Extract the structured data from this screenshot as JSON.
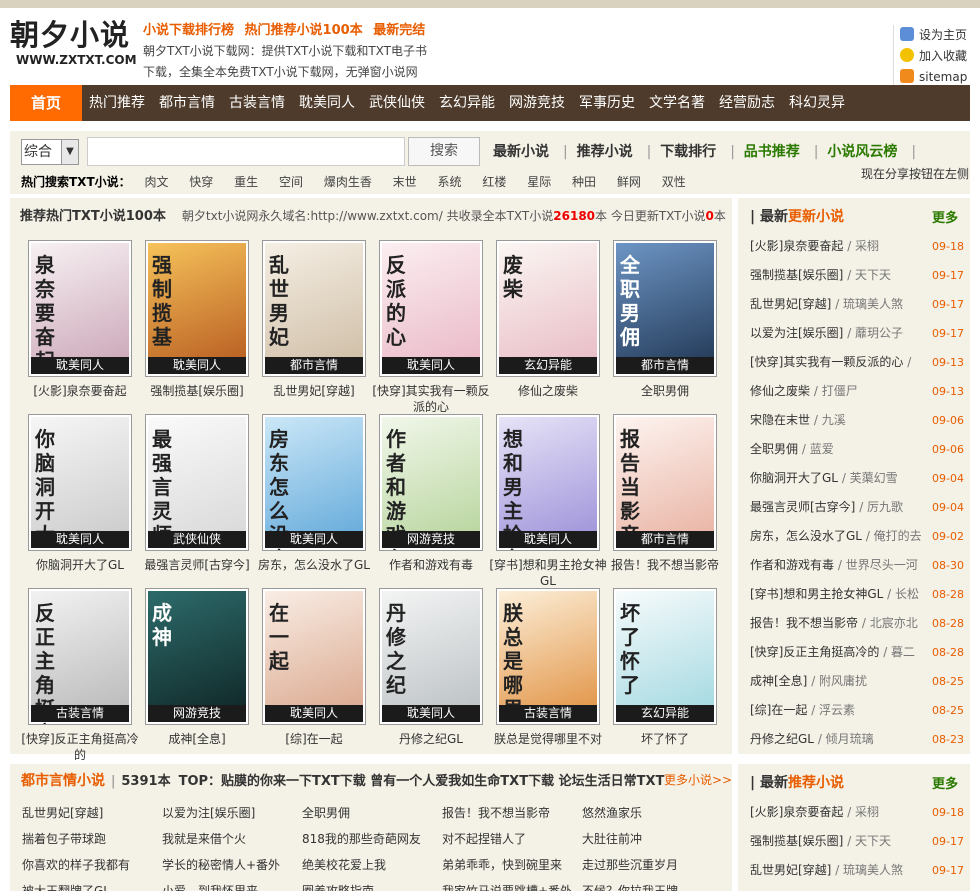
{
  "header": {
    "logo_text": "朝夕小说",
    "logo_url": "WWW.ZXTXT.COM",
    "links": [
      "小说下载排行榜",
      "热门推荐小说100本",
      "最新完结"
    ],
    "desc1": "朝夕TXT小说下载网：提供TXT小说下载和TXT电子书",
    "desc2": "下载，全集全本免费TXT小说下载网，无弹窗小说网",
    "side_links": [
      {
        "label": "设为主页",
        "icon": "home-icon",
        "color": "#5b8ed6"
      },
      {
        "label": "加入收藏",
        "icon": "star-icon",
        "color": "#f2c200"
      },
      {
        "label": "sitemap",
        "icon": "rss-icon",
        "color": "#f08a1c"
      }
    ]
  },
  "nav": [
    "首页",
    "热门推荐",
    "都市言情",
    "古装言情",
    "耽美同人",
    "武侠仙侠",
    "玄幻异能",
    "网游竞技",
    "军事历史",
    "文学名著",
    "经营励志",
    "科幻灵异"
  ],
  "search": {
    "select_value": "综合",
    "input_value": "",
    "button_label": "搜索",
    "quick_links": [
      "最新小说",
      "推荐小说",
      "下载排行",
      "品书推荐",
      "小说风云榜"
    ],
    "hot_label": "热门搜索TXT小说：",
    "hot_words": [
      "肉文",
      "快穿",
      "重生",
      "空间",
      "爆肉生香",
      "末世",
      "系统",
      "红楼",
      "星际",
      "种田",
      "鲜网",
      "双性"
    ],
    "share_tip": "现在分享按钮在左侧"
  },
  "main": {
    "title": "推荐热门TXT小说100本",
    "info_pre": "朝夕txt小说网永久域名:http://www.zxtxt.com/ 共收录全本TXT小说",
    "total": "26180",
    "info_mid": "本 今日更新TXT小说",
    "today": "0",
    "info_post": "本",
    "books": [
      {
        "name": "[火影]泉奈要奋起",
        "cat": "耽美同人",
        "cover": "泉奈要奋起",
        "c1": "#f7f1f3",
        "c2": "#c9a3b5"
      },
      {
        "name": "强制揽基[娱乐圈]",
        "cat": "耽美同人",
        "cover": "强制揽基",
        "c1": "#f6c25a",
        "c2": "#b5581f"
      },
      {
        "name": "乱世男妃[穿越]",
        "cat": "都市言情",
        "cover": "乱世男妃",
        "c1": "#f5efe4",
        "c2": "#cdbba3"
      },
      {
        "name": "[快穿]其实我有一颗反派的心",
        "cat": "耽美同人",
        "cover": "反派的心",
        "c1": "#fbeef1",
        "c2": "#e9b7c5"
      },
      {
        "name": "修仙之废柴",
        "cat": "玄幻异能",
        "cover": "废柴",
        "c1": "#fbf6f3",
        "c2": "#e7b9c3"
      },
      {
        "name": "全职男佣",
        "cat": "都市言情",
        "cover": "全职男佣",
        "c1": "#6d95c4",
        "c2": "#1f3552"
      },
      {
        "name": "你脑洞开大了GL",
        "cat": "耽美同人",
        "cover": "你脑洞开大了",
        "c1": "#f6f6f6",
        "c2": "#c9c9c9"
      },
      {
        "name": "最强言灵师[古穿今]",
        "cat": "武侠仙侠",
        "cover": "最强言灵师",
        "c1": "#fafafa",
        "c2": "#d7d7d7"
      },
      {
        "name": "房东，怎么没水了GL",
        "cat": "耽美同人",
        "cover": "房东怎么没水了",
        "c1": "#cbe7f7",
        "c2": "#5fa7d9"
      },
      {
        "name": "作者和游戏有毒",
        "cat": "网游竞技",
        "cover": "作者和游戏有毒",
        "c1": "#f1f7ea",
        "c2": "#b5d39a"
      },
      {
        "name": "[穿书]想和男主抢女神GL",
        "cat": "耽美同人",
        "cover": "想和男主抢女神",
        "c1": "#e7e3f7",
        "c2": "#9a8fd8"
      },
      {
        "name": "报告！我不想当影帝",
        "cat": "都市言情",
        "cover": "报告当影帝",
        "c1": "#fdf4f0",
        "c2": "#e8b0a0"
      },
      {
        "name": "[快穿]反正主角挺高冷的",
        "cat": "古装言情",
        "cover": "反正主角挺高冷",
        "c1": "#f2f2f2",
        "c2": "#b7b7b7"
      },
      {
        "name": "成神[全息]",
        "cat": "网游竞技",
        "cover": "成神",
        "c1": "#2d6b6b",
        "c2": "#0f2424"
      },
      {
        "name": "[综]在一起",
        "cat": "耽美同人",
        "cover": "在一起",
        "c1": "#f9ede5",
        "c2": "#d9a58a"
      },
      {
        "name": "丹修之纪GL",
        "cat": "耽美同人",
        "cover": "丹修之纪",
        "c1": "#f3f4f4",
        "c2": "#b9bfc2"
      },
      {
        "name": "朕总是觉得哪里不对",
        "cat": "古装言情",
        "cover": "朕总是哪里不对",
        "c1": "#fcefd9",
        "c2": "#e08f3e"
      },
      {
        "name": "坏了怀了",
        "cat": "玄幻异能",
        "cover": "坏了怀了",
        "c1": "#f7fbfb",
        "c2": "#9fd7e0"
      }
    ]
  },
  "city": {
    "title": "都市言情小说",
    "count": "5391本",
    "top": "TOP：贴膜的你来一下TXT下载  曾有一个人爱我如生命TXT下载  论坛生活日常TXT",
    "more": "更多小说>>",
    "rows": [
      [
        "乱世男妃[穿越]",
        "以爱为注[娱乐圈]",
        "全职男佣",
        "报告！我不想当影帝",
        "悠然渔家乐"
      ],
      [
        "揣着包子带球跑",
        "我就是来借个火",
        "818我的那些奇葩网友",
        "对不起捏错人了",
        "大肚往前冲"
      ],
      [
        "你喜欢的样子我都有",
        "学长的秘密情人+番外",
        "绝美校花爱上我",
        "弟弟乖乖，快到碗里来",
        "走过那些沉重岁月"
      ],
      [
        "被大王翻牌了GL",
        "小爱，到我怀里来",
        "圈养攻略指南",
        "我家竹马说要跳槽+番外",
        "不候？你拉我王牌"
      ]
    ]
  },
  "side1": {
    "title_a": "最新",
    "title_b": "更新小说",
    "more": "更多",
    "items": [
      {
        "book": "[火影]泉奈要奋起",
        "author": "采栩",
        "date": "09-18"
      },
      {
        "book": "强制揽基[娱乐圈]",
        "author": "天下天",
        "date": "09-17"
      },
      {
        "book": "乱世男妃[穿越]",
        "author": "琉璃美人煞",
        "date": "09-17"
      },
      {
        "book": "以爱为注[娱乐圈]",
        "author": "蘼玥公子",
        "date": "09-17"
      },
      {
        "book": "[快穿]其实我有一颗反派的心",
        "author": "",
        "date": "09-13"
      },
      {
        "book": "修仙之废柴",
        "author": "打僵尸",
        "date": "09-13"
      },
      {
        "book": "宋隐在末世",
        "author": "九溪",
        "date": "09-06"
      },
      {
        "book": "全职男佣",
        "author": "蓝爱",
        "date": "09-06"
      },
      {
        "book": "你脑洞开大了GL",
        "author": "芙蕖幻雪",
        "date": "09-04"
      },
      {
        "book": "最强言灵师[古穿今]",
        "author": "厉九歌",
        "date": "09-04"
      },
      {
        "book": "房东，怎么没水了GL",
        "author": "俺打的去",
        "date": "09-02"
      },
      {
        "book": "作者和游戏有毒",
        "author": "世界尽头一河",
        "date": "08-30"
      },
      {
        "book": "[穿书]想和男主抢女神GL",
        "author": "长松",
        "date": "08-28"
      },
      {
        "book": "报告！我不想当影帝",
        "author": "北宸亦北",
        "date": "08-28"
      },
      {
        "book": "[快穿]反正主角挺高冷的",
        "author": "暮二",
        "date": "08-28"
      },
      {
        "book": "成神[全息]",
        "author": "附风庸扰",
        "date": "08-25"
      },
      {
        "book": "[综]在一起",
        "author": "浮云素",
        "date": "08-25"
      },
      {
        "book": "丹修之纪GL",
        "author": "倾月琉璃",
        "date": "08-23"
      }
    ]
  },
  "side2": {
    "title_a": "最新",
    "title_b": "推荐小说",
    "more": "更多",
    "items": [
      {
        "book": "[火影]泉奈要奋起",
        "author": "采栩",
        "date": "09-18"
      },
      {
        "book": "强制揽基[娱乐圈]",
        "author": "天下天",
        "date": "09-17"
      },
      {
        "book": "乱世男妃[穿越]",
        "author": "琉璃美人煞",
        "date": "09-17"
      }
    ]
  }
}
